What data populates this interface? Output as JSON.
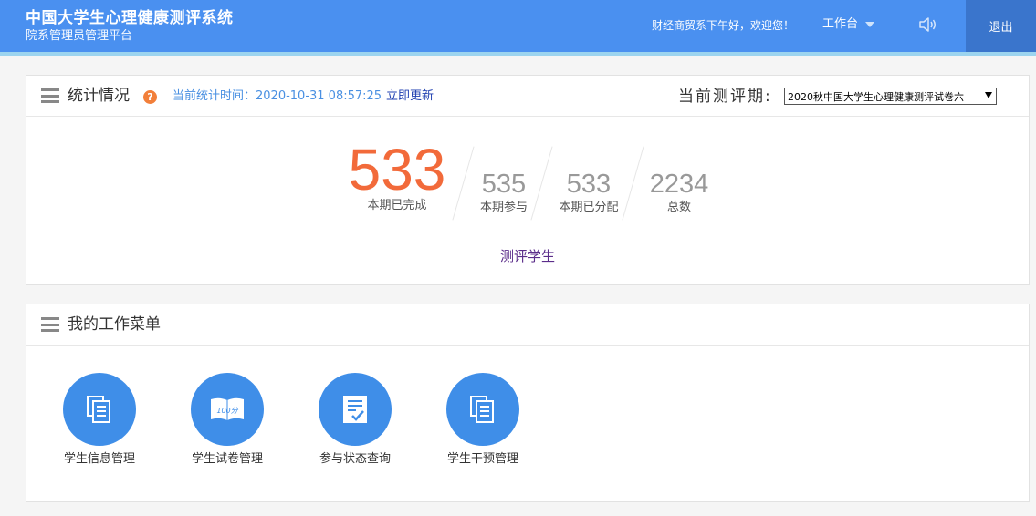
{
  "header": {
    "title": "中国大学生心理健康测评系统",
    "subtitle": "院系管理员管理平台",
    "greeting": "财经商贸系下午好，欢迎您！",
    "workbench_label": "工作台",
    "logout_label": "退出",
    "colors": {
      "bar": "#4a90f0",
      "logout_bg": "#3a75cc",
      "stripe": "#9cd4ef"
    }
  },
  "stats": {
    "title": "统计情况",
    "help_glyph": "?",
    "time_text": "当前统计时间：2020-10-31 08:57:25",
    "update_label": "立即更新",
    "period_label": "当前测评期:",
    "period_value": "2020秋中国大学生心理健康测评试卷六",
    "items": [
      {
        "value": "533",
        "label": "本期已完成"
      },
      {
        "value": "535",
        "label": "本期参与"
      },
      {
        "value": "533",
        "label": "本期已分配"
      },
      {
        "value": "2234",
        "label": "总数"
      }
    ],
    "link_label": "测评学生",
    "colors": {
      "highlight": "#f26a3a",
      "muted": "#999999"
    }
  },
  "menu": {
    "title": "我的工作菜单",
    "items": [
      {
        "label": "学生信息管理",
        "icon": "document-list-icon"
      },
      {
        "label": "学生试卷管理",
        "icon": "exam-book-icon",
        "icon_text": "100分"
      },
      {
        "label": "参与状态查询",
        "icon": "checklist-icon"
      },
      {
        "label": "学生干预管理",
        "icon": "document-list-icon"
      }
    ],
    "colors": {
      "circle": "#3f8ee8"
    }
  }
}
